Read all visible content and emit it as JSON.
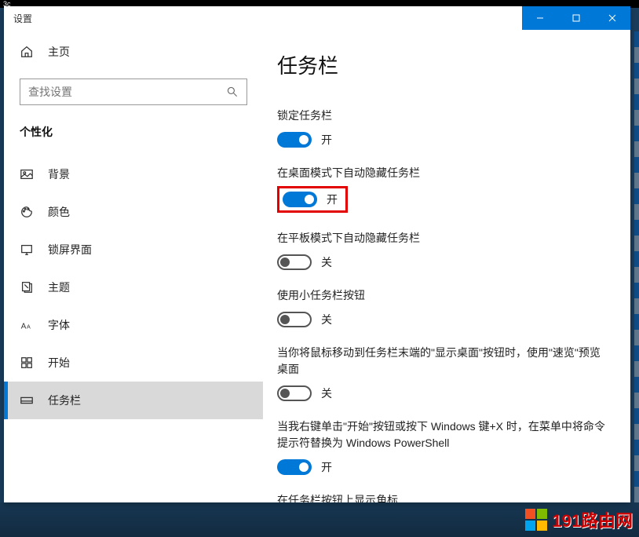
{
  "window": {
    "title": "设置"
  },
  "titlebar": {
    "minimize": "minimize",
    "maximize": "maximize",
    "close": "close"
  },
  "sidebar": {
    "home": "主页",
    "searchPlaceholder": "查找设置",
    "category": "个性化",
    "items": [
      {
        "key": "background",
        "label": "背景"
      },
      {
        "key": "colors",
        "label": "颜色"
      },
      {
        "key": "lockscreen",
        "label": "锁屏界面"
      },
      {
        "key": "themes",
        "label": "主题"
      },
      {
        "key": "fonts",
        "label": "字体"
      },
      {
        "key": "start",
        "label": "开始"
      },
      {
        "key": "taskbar",
        "label": "任务栏"
      }
    ]
  },
  "page": {
    "title": "任务栏",
    "onText": "开",
    "offText": "关",
    "settings": [
      {
        "label": "锁定任务栏",
        "state": "on",
        "highlight": false
      },
      {
        "label": "在桌面模式下自动隐藏任务栏",
        "state": "on",
        "highlight": true
      },
      {
        "label": "在平板模式下自动隐藏任务栏",
        "state": "off",
        "highlight": false
      },
      {
        "label": "使用小任务栏按钮",
        "state": "off",
        "highlight": false
      },
      {
        "label": "当你将鼠标移动到任务栏末端的\"显示桌面\"按钮时，使用\"速览\"预览桌面",
        "state": "off",
        "highlight": false
      },
      {
        "label": "当我右键单击\"开始\"按钮或按下 Windows 键+X 时，在菜单中将命令提示符替换为 Windows PowerShell",
        "state": "on",
        "highlight": false
      },
      {
        "label": "在任务栏按钮上显示角标",
        "state": null,
        "highlight": false
      }
    ]
  },
  "watermark": "191路由网"
}
